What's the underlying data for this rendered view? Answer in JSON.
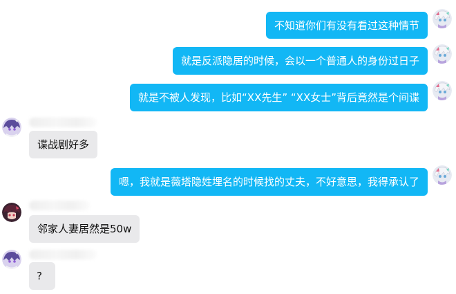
{
  "messages": [
    {
      "side": "self",
      "text": "不知道你们有没有看过这种情节"
    },
    {
      "side": "self",
      "text": "就是反派隐居的时候，会以一个普通人的身份过日子"
    },
    {
      "side": "self",
      "text": "就是不被人发现，比如“XX先生” “XX女士”背后竟然是个间谍"
    },
    {
      "side": "other",
      "text": "谍战剧好多"
    },
    {
      "side": "self",
      "text": "嗯，我就是薇塔隐姓埋名的时候找的丈夫，不好意思，我得承认了"
    },
    {
      "side": "other",
      "text": "邻家人妻居然是50w"
    },
    {
      "side": "other",
      "text": "?"
    }
  ],
  "colors": {
    "self_bubble": "#12b7f5",
    "other_bubble": "#e9e9eb",
    "background": "#ffffff"
  },
  "icons": {
    "self_avatar": "anime-avatar-white-hair",
    "other_avatar_1": "anime-avatar-purple",
    "other_avatar_2": "anime-avatar-dark-red"
  }
}
